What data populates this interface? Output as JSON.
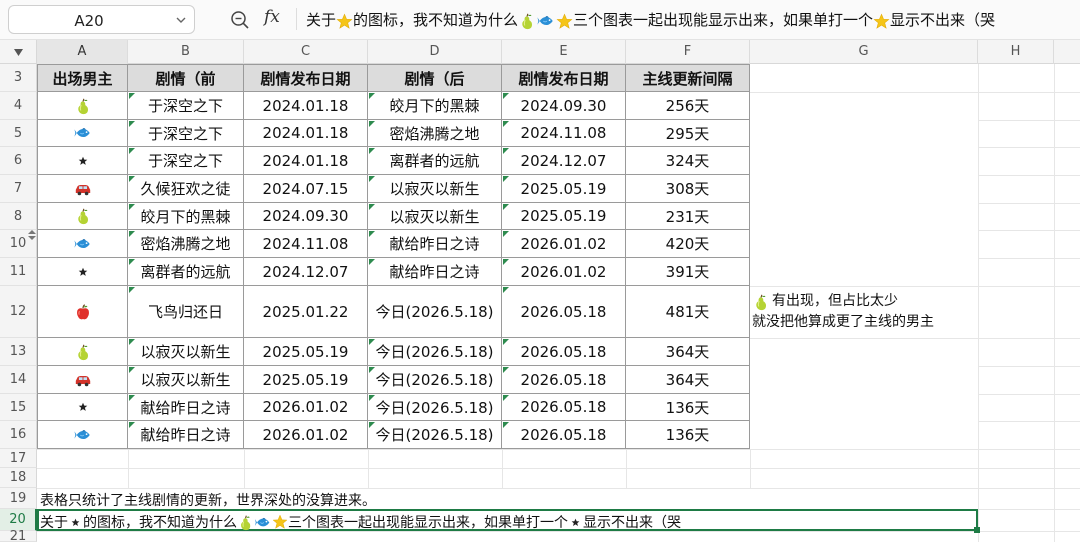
{
  "formula_bar": {
    "cell_ref": "A20",
    "text_1": "关于",
    "text_2": "的图标，我不知道为什么",
    "text_3": "三个图表一起出现能显示出来，如果单打一个",
    "text_4": "显示不出来（哭"
  },
  "columns": [
    "A",
    "B",
    "C",
    "D",
    "E",
    "F",
    "G",
    "H"
  ],
  "rows": [
    "3",
    "4",
    "5",
    "6",
    "7",
    "8",
    "10",
    "11",
    "12",
    "13",
    "14",
    "15",
    "16",
    "17",
    "18",
    "19",
    "20",
    "21"
  ],
  "active_row": "20",
  "table": {
    "headers": [
      "出场男主",
      "剧情（前",
      "剧情发布日期",
      "剧情（后",
      "剧情发布日期",
      "主线更新间隔"
    ],
    "rows": [
      {
        "icon": "pear-icon",
        "b": "于深空之下",
        "c": "2024.01.18",
        "d": "皎月下的黑棘",
        "e": "2024.09.30",
        "f": "256天"
      },
      {
        "icon": "fish-icon",
        "b": "于深空之下",
        "c": "2024.01.18",
        "d": "密焰沸腾之地",
        "e": "2024.11.08",
        "f": "295天"
      },
      {
        "icon": "star-icon",
        "b": "于深空之下",
        "c": "2024.01.18",
        "d": "离群者的远航",
        "e": "2024.12.07",
        "f": "324天"
      },
      {
        "icon": "car-icon",
        "b": "久候狂欢之徒",
        "c": "2024.07.15",
        "d": "以寂灭以新生",
        "e": "2025.05.19",
        "f": "308天"
      },
      {
        "icon": "pear-icon",
        "b": "皎月下的黑棘",
        "c": "2024.09.30",
        "d": "以寂灭以新生",
        "e": "2025.05.19",
        "f": "231天"
      },
      {
        "icon": "fish-icon",
        "b": "密焰沸腾之地",
        "c": "2024.11.08",
        "d": "献给昨日之诗",
        "e": "2026.01.02",
        "f": "420天"
      },
      {
        "icon": "star-icon",
        "b": "离群者的远航",
        "c": "2024.12.07",
        "d": "献给昨日之诗",
        "e": "2026.01.02",
        "f": "391天"
      },
      {
        "icon": "apple-icon",
        "b": "飞鸟归还日",
        "c": "2025.01.22",
        "d": "今日(2026.5.18)",
        "e": "2026.05.18",
        "f": "481天"
      },
      {
        "icon": "pear-icon",
        "b": "以寂灭以新生",
        "c": "2025.05.19",
        "d": "今日(2026.5.18)",
        "e": "2026.05.18",
        "f": "364天"
      },
      {
        "icon": "car-icon",
        "b": "以寂灭以新生",
        "c": "2025.05.19",
        "d": "今日(2026.5.18)",
        "e": "2026.05.18",
        "f": "364天"
      },
      {
        "icon": "star-icon",
        "b": "献给昨日之诗",
        "c": "2026.01.02",
        "d": "今日(2026.5.18)",
        "e": "2026.05.18",
        "f": "136天"
      },
      {
        "icon": "fish-icon",
        "b": "献给昨日之诗",
        "c": "2026.01.02",
        "d": "今日(2026.5.18)",
        "e": "2026.05.18",
        "f": "136天"
      }
    ]
  },
  "note_g12": {
    "line1": "有出现，但占比太少",
    "line2": "就没把他算成更了主线的男主"
  },
  "row19_text": "表格只统计了主线剧情的更新，世界深处的没算进来。",
  "row20": {
    "text_1": "关于",
    "text_2": "的图标，我不知道为什么",
    "text_3": "三个图表一起出现能显示出来，如果单打一个",
    "text_4": "显示不出来（哭"
  },
  "colors": {
    "accent_green": "#1e7b45",
    "header_fill": "#dcdcdc",
    "star_yellow": "#f5c518",
    "fish_blue": "#2b8fd6",
    "pear_green": "#b5d334",
    "apple_red": "#e0302a",
    "car_red": "#d2332a"
  }
}
